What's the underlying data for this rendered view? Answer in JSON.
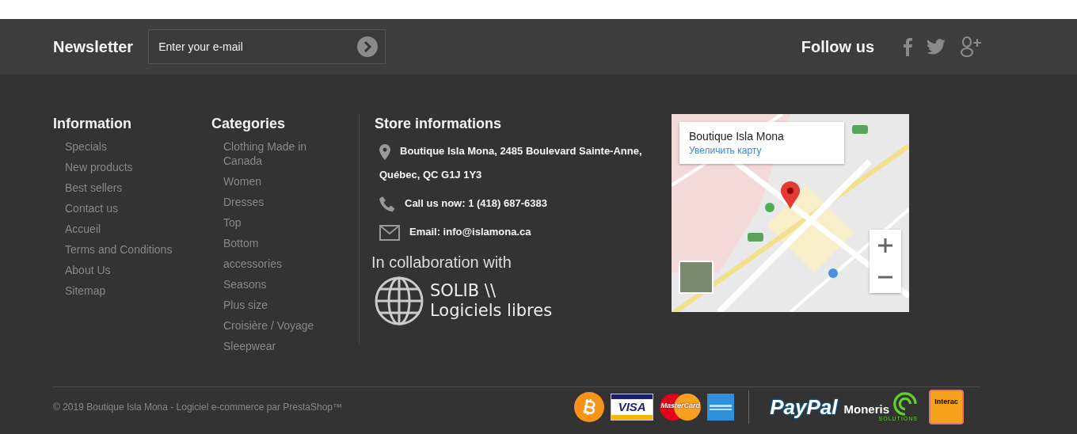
{
  "newsletter": {
    "title": "Newsletter",
    "placeholder": "Enter your e-mail"
  },
  "follow": {
    "title": "Follow us",
    "networks": [
      {
        "kind": "facebook"
      },
      {
        "kind": "twitter"
      },
      {
        "kind": "googleplus"
      }
    ]
  },
  "information": {
    "title": "Information",
    "links": [
      "Specials",
      "New products",
      "Best sellers",
      "Contact us",
      "Accueil",
      "Terms and Conditions",
      "About Us",
      "Sitemap"
    ]
  },
  "categories": {
    "title": "Categories",
    "links": [
      "Clothing Made in Canada",
      "Women",
      "Dresses",
      "Top",
      "Bottom",
      "accessories",
      "Seasons",
      "Plus size",
      "Croisière / Voyage",
      "Sleepwear"
    ]
  },
  "store": {
    "title": "Store informations",
    "items": [
      {
        "kind": "address",
        "text": "Boutique Isla Mona, 2485 Boulevard Sainte-Anne,",
        "continuation": "Québec, QC G1J 1Y3"
      },
      {
        "kind": "phone",
        "text": "Call us now: 1 (418) 687-6383"
      },
      {
        "kind": "email",
        "text": "Email: info@islamona.ca"
      }
    ]
  },
  "collaboration": {
    "title": "In collaboration with",
    "logo_lines": [
      "SOLIB \\\\",
      "Logiciels libres"
    ]
  },
  "map": {
    "kind": "picture",
    "card_title": "Boutique Isla Mona",
    "card_link": "Увеличить карту"
  },
  "copyright": "© 2019 Boutique Isla Mona - Logiciel e-commerce par PrestaShop™",
  "cards": [
    {
      "kind": "bitcoin"
    },
    {
      "kind": "visa",
      "label": "VISA"
    },
    {
      "kind": "mastercard",
      "label": "MasterCard"
    },
    {
      "kind": "amex"
    }
  ],
  "processors": [
    {
      "kind": "paypal",
      "label": "PayPal"
    },
    {
      "kind": "moneris",
      "label": "Moneris",
      "sublabel": "SOLUTIONS"
    },
    {
      "kind": "interac",
      "label": "Interac"
    }
  ]
}
